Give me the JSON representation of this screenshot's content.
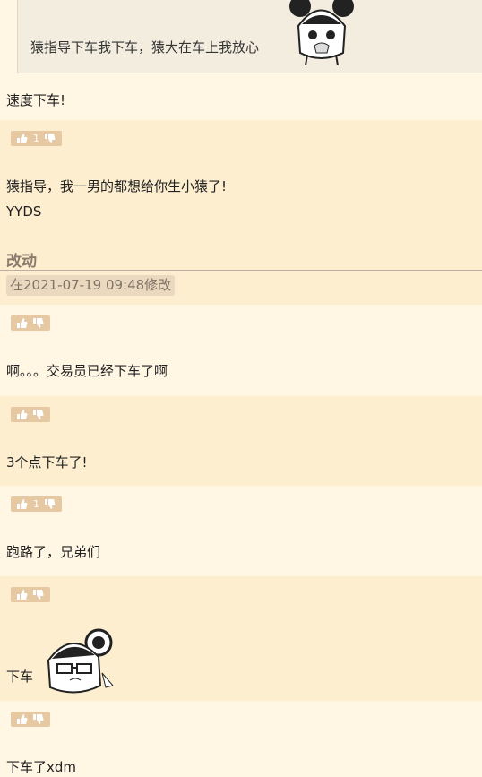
{
  "posts": [
    {
      "quote_text": "猿指导下车我下车，猿大在车上我放心",
      "text": "速度下车!"
    },
    {
      "votes": "1",
      "text_line1": "猿指导，我一男的都想给你生小猿了!",
      "text_line2": "YYDS",
      "edit_title": "改动",
      "edit_note": "在2021-07-19 09:48修改"
    },
    {
      "votes": "",
      "text": "啊。。。交易员已经下车了啊"
    },
    {
      "votes": "",
      "text": "3个点下车了!"
    },
    {
      "votes": "1",
      "text": "跑路了，兄弟们"
    },
    {
      "votes": "",
      "text": "下车"
    },
    {
      "votes": "",
      "text": "下车了xdm"
    }
  ],
  "colors": {
    "bg_light": "#fff6e4",
    "bg_alt": "#fdeecf",
    "vote_bg": "#e6c8a2",
    "quote_bg": "#f3ede0"
  },
  "icons": {
    "thumb_up": "thumb-up-icon",
    "thumb_down": "thumb-down-icon",
    "sticker": "anime-girl-sticker"
  }
}
